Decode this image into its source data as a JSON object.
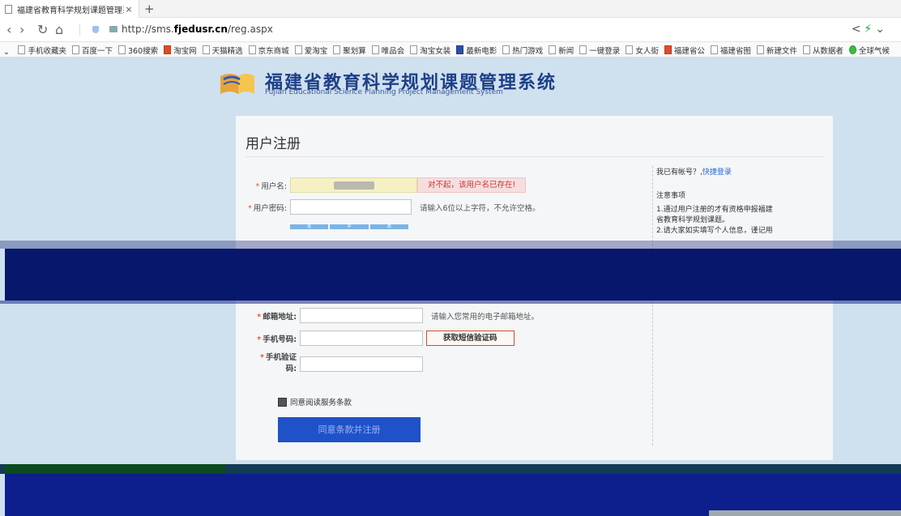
{
  "browser": {
    "tab_title": "福建省教育科学规划课题管理系统",
    "tab_close": "×",
    "new_tab": "+",
    "url_prefix": "http://sms.",
    "url_domain": "fjedusr.cn",
    "url_path": "/reg.aspx",
    "favorites": [
      {
        "label": "手机收藏夹",
        "icon": "doc"
      },
      {
        "label": "百度一下",
        "icon": "doc"
      },
      {
        "label": "360搜索",
        "icon": "doc"
      },
      {
        "label": "淘宝网",
        "icon": "red"
      },
      {
        "label": "天猫精选",
        "icon": "doc"
      },
      {
        "label": "京东商城",
        "icon": "doc"
      },
      {
        "label": "爱淘宝",
        "icon": "doc"
      },
      {
        "label": "聚划算",
        "icon": "doc"
      },
      {
        "label": "唯品会",
        "icon": "doc"
      },
      {
        "label": "淘宝女装",
        "icon": "doc"
      },
      {
        "label": "最新电影",
        "icon": "blue"
      },
      {
        "label": "热门游戏",
        "icon": "doc"
      },
      {
        "label": "新闻",
        "icon": "doc"
      },
      {
        "label": "一键登录",
        "icon": "doc"
      },
      {
        "label": "女人街",
        "icon": "doc"
      },
      {
        "label": "福建省公",
        "icon": "red"
      },
      {
        "label": "福建省图",
        "icon": "doc"
      },
      {
        "label": "新建文件",
        "icon": "doc"
      },
      {
        "label": "从数据者",
        "icon": "doc"
      },
      {
        "label": "全球气候",
        "icon": "green"
      }
    ]
  },
  "header": {
    "title": "福建省教育科学规划课题管理系统",
    "subtitle": "Fujian Educational Science Planning Project Management System"
  },
  "form": {
    "title": "用户注册",
    "username_label": "用户名:",
    "username_error": "对不起，该用户名已存在!",
    "password_label": "用户密码:",
    "password_hint": "请输入6位以上字符，不允许空格。",
    "strength_low": "低",
    "strength_mid": "中",
    "strength_high": "高",
    "email_label": "邮箱地址:",
    "email_hint": "请输入您常用的电子邮箱地址。",
    "phone_label": "手机号码:",
    "sms_button": "获取短信验证码",
    "sms_code_label_1": "手机验证",
    "sms_code_label_2": "码:",
    "agree_text": "同意阅读服务条款",
    "submit": "同意条款并注册"
  },
  "sidebar": {
    "have_account": "我已有帐号？,",
    "quick_login": "快捷登录",
    "notes_title": "注意事项",
    "note_1a": "1.通过用户注册的才有资格申报福建",
    "note_1b": "省教育科学规划课题。",
    "note_2": "2.请大家如实填写个人信息，谨记用"
  }
}
